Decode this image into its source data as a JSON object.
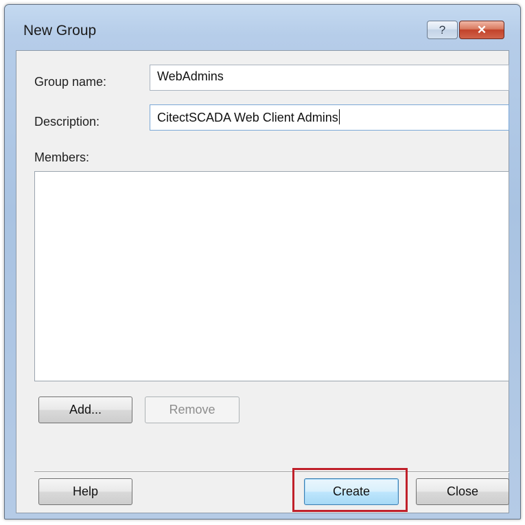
{
  "window": {
    "title": "New Group",
    "help_glyph": "?",
    "close_glyph": "✕"
  },
  "form": {
    "group_name_label": "Group name:",
    "group_name_value": "WebAdmins",
    "description_label": "Description:",
    "description_value": "CitectSCADA Web Client Admins",
    "members_label": "Members:",
    "members": []
  },
  "buttons": {
    "add": "Add...",
    "remove": "Remove",
    "help": "Help",
    "create": "Create",
    "close": "Close"
  },
  "colors": {
    "highlight_box": "#c0202a",
    "default_button": "#bee6fd"
  },
  "icons": {
    "title_help": "help-icon",
    "title_close": "close-icon"
  }
}
